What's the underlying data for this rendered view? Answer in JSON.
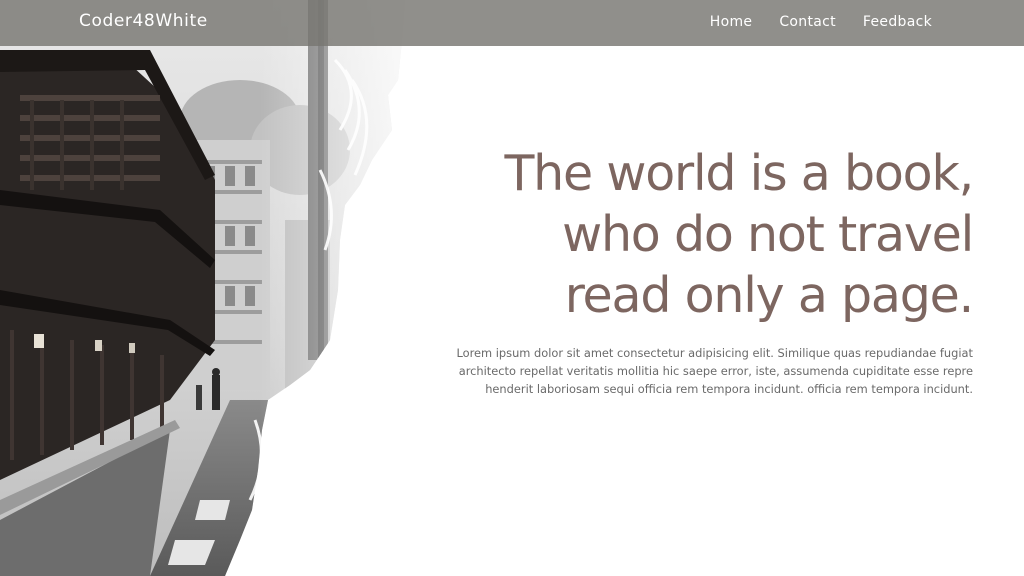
{
  "navbar": {
    "brand": "Coder48White",
    "links": [
      "Home",
      "Contact",
      "Feedback"
    ]
  },
  "hero": {
    "title_lines": [
      "The world is a book,",
      "who do not travel",
      "read only a page."
    ],
    "paragraph": "Lorem ipsum dolor sit amet consectetur adipisicing elit. Similique quas repudiandae fugiat architecto repellat veritatis mollitia hic saepe error, iste, assumenda cupiditate esse repre henderit laboriosam sequi officia rem tempora incidunt. officia rem tempora incidunt."
  },
  "colors": {
    "navbar_bg": "#787672",
    "title": "#7d6660",
    "paragraph": "#6a6a6a",
    "background": "#ffffff"
  },
  "images": {
    "hero_photo": "black-and-white street with traditional wooden buildings"
  }
}
